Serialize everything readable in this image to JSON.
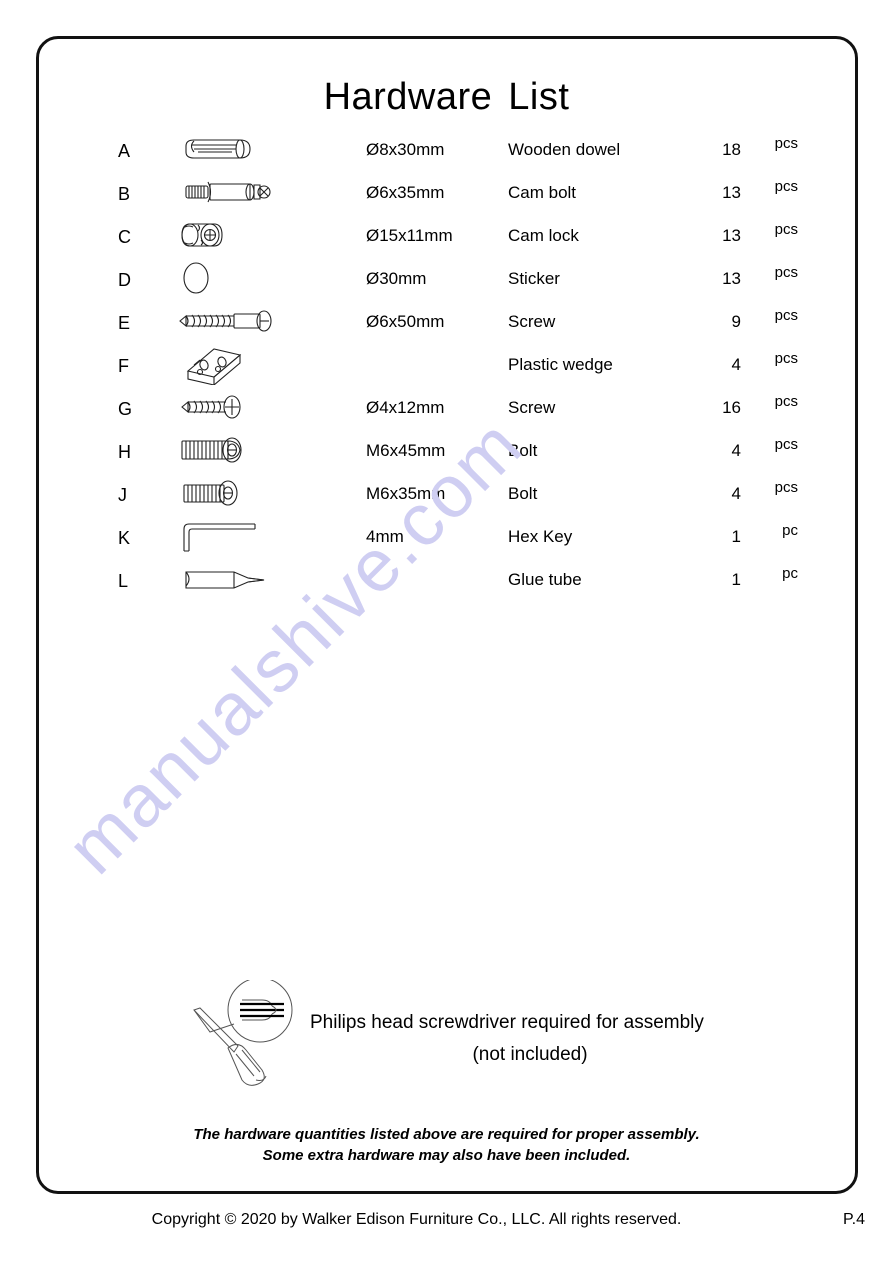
{
  "document": {
    "title_part1": "Hardware",
    "title_part2": "List",
    "page_number": "P.4",
    "copyright": "Copyright  © 2020 by Walker Edison Furniture Co., LLC. All rights reserved."
  },
  "hardware": {
    "rows": [
      {
        "letter": "A",
        "icon": "wooden-dowel-icon",
        "spec": "Ø8x30mm",
        "name": "Wooden dowel",
        "qty": "18",
        "unit": "pcs"
      },
      {
        "letter": "B",
        "icon": "cam-bolt-icon",
        "spec": "Ø6x35mm",
        "name": "Cam bolt",
        "qty": "13",
        "unit": "pcs"
      },
      {
        "letter": "C",
        "icon": "cam-lock-icon",
        "spec": "Ø15x11mm",
        "name": "Cam lock",
        "qty": "13",
        "unit": "pcs"
      },
      {
        "letter": "D",
        "icon": "sticker-icon",
        "spec": "Ø30mm",
        "name": "Sticker",
        "qty": "13",
        "unit": "pcs"
      },
      {
        "letter": "E",
        "icon": "screw-long-icon",
        "spec": "Ø6x50mm",
        "name": "Screw",
        "qty": "9",
        "unit": "pcs"
      },
      {
        "letter": "F",
        "icon": "plastic-wedge-icon",
        "spec": "",
        "name": "Plastic wedge",
        "qty": "4",
        "unit": "pcs"
      },
      {
        "letter": "G",
        "icon": "screw-short-icon",
        "spec": "Ø4x12mm",
        "name": "Screw",
        "qty": "16",
        "unit": "pcs"
      },
      {
        "letter": "H",
        "icon": "bolt-long-icon",
        "spec": "M6x45mm",
        "name": "Bolt",
        "qty": "4",
        "unit": "pcs"
      },
      {
        "letter": "J",
        "icon": "bolt-short-icon",
        "spec": "M6x35mm",
        "name": "Bolt",
        "qty": "4",
        "unit": "pcs"
      },
      {
        "letter": "K",
        "icon": "hex-key-icon",
        "spec": "4mm",
        "name": "Hex Key",
        "qty": "1",
        "unit": "pc"
      },
      {
        "letter": "L",
        "icon": "glue-tube-icon",
        "spec": "",
        "name": "Glue tube",
        "qty": "1",
        "unit": "pc"
      }
    ]
  },
  "tool_note": {
    "line1": "Philips head screwdriver required for assembly",
    "line2": "(not included)"
  },
  "footnote": {
    "line1": "The hardware quantities listed above are required for proper assembly.",
    "line2": "Some extra hardware may also have been included."
  },
  "watermark": {
    "text": "manualshive.com",
    "color": "#cfcef2"
  }
}
